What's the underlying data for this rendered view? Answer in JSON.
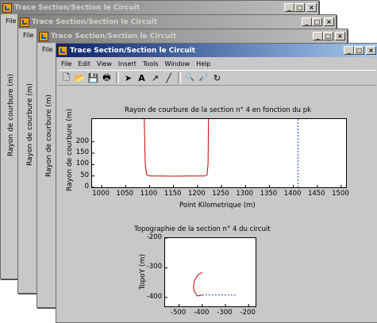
{
  "window_title": "Trace Section/Section le Circuit",
  "background_windows": [
    {
      "title": "Trace Section/Section le Circuit",
      "menu_first": "File",
      "ylabel": "Rayon de courbure (m)"
    },
    {
      "title": "Trace Section/Section le Circuit",
      "menu_first": "File",
      "ylabel": "Rayon de courbure (m)"
    },
    {
      "title": "Trace Section/Section le Circuit",
      "menu_first": "File",
      "ylabel": "Rayon de courbure (m)"
    }
  ],
  "window_buttons": {
    "minimize": "_",
    "maximize": "□",
    "close": "×"
  },
  "menu": [
    "File",
    "Edit",
    "View",
    "Insert",
    "Tools",
    "Window",
    "Help"
  ],
  "toolbar": [
    {
      "icon": "new-file-icon",
      "glyph": "🗋"
    },
    {
      "icon": "open-folder-icon",
      "glyph": "📂"
    },
    {
      "icon": "save-icon",
      "glyph": "💾"
    },
    {
      "icon": "print-icon",
      "glyph": "🖶"
    },
    {
      "icon": "select-arrow-icon",
      "glyph": "➤"
    },
    {
      "icon": "text-icon",
      "glyph": "A"
    },
    {
      "icon": "arrow-icon",
      "glyph": "↗"
    },
    {
      "icon": "line-icon",
      "glyph": "╱"
    },
    {
      "icon": "zoom-in-icon",
      "glyph": "🔍"
    },
    {
      "icon": "zoom-out-icon",
      "glyph": "🔎"
    },
    {
      "icon": "rotate-icon",
      "glyph": "↻"
    }
  ],
  "chart_data": [
    {
      "type": "line",
      "title": "Rayon de courbure de la section n° 4 en fonction du pk",
      "xlabel": "Point Kilometrique (m)",
      "ylabel": "Rayon de courbure (m)",
      "xlim": [
        980,
        1510
      ],
      "ylim": [
        0,
        300
      ],
      "xticks": [
        1000,
        1050,
        1100,
        1150,
        1200,
        1250,
        1300,
        1350,
        1400,
        1450,
        1500
      ],
      "yticks": [
        0,
        50,
        100,
        150,
        200
      ],
      "series": [
        {
          "color": "#cc0000",
          "style": "solid",
          "x": [
            1089,
            1090,
            1091,
            1094,
            1100,
            1120,
            1150,
            1180,
            1200,
            1215,
            1220,
            1222,
            1223
          ],
          "y": [
            300,
            200,
            100,
            55,
            50,
            50,
            49,
            50,
            50,
            50,
            55,
            100,
            300
          ]
        },
        {
          "color": "#2040c0",
          "style": "dashed",
          "x": [
            1410,
            1410
          ],
          "y": [
            0,
            300
          ]
        }
      ]
    },
    {
      "type": "line",
      "title": "Topographie de la section n° 4 du circuit",
      "xlabel": "",
      "ylabel": "TopoY (m)",
      "xlim": [
        -560,
        -170
      ],
      "ylim": [
        -430,
        -200
      ],
      "xticks": [
        -500,
        -400,
        -300,
        -200
      ],
      "yticks": [
        -200,
        -300,
        -400
      ],
      "series": [
        {
          "color": "#cc0000",
          "style": "solid",
          "x": [
            -400,
            -420,
            -434,
            -438,
            -434,
            -420,
            -400
          ],
          "y": [
            -315,
            -325,
            -345,
            -365,
            -380,
            -395,
            -392
          ]
        },
        {
          "color": "#2040c0",
          "style": "dashed",
          "x": [
            -400,
            -250
          ],
          "y": [
            -392,
            -392
          ]
        }
      ]
    }
  ]
}
